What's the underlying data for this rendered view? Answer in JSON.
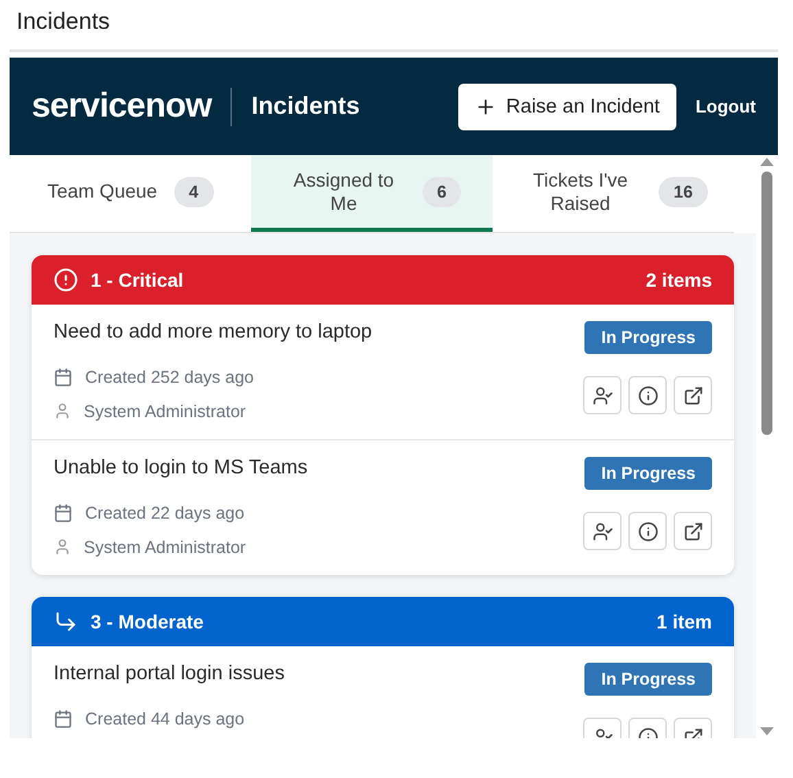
{
  "page_title": "Incidents",
  "header": {
    "logo": "servicenow",
    "title": "Incidents",
    "raise_button": "Raise an Incident",
    "logout": "Logout"
  },
  "tabs": [
    {
      "label": "Team Queue",
      "count": "4",
      "selected": false
    },
    {
      "label": "Assigned to Me",
      "count": "6",
      "selected": true
    },
    {
      "label": "Tickets I've Raised",
      "count": "16",
      "selected": false
    }
  ],
  "groups": [
    {
      "kind": "critical",
      "label": "1 - Critical",
      "count": "2 items",
      "color": "#d9202b",
      "items": [
        {
          "title": "Need to add more memory to laptop",
          "created": "Created 252 days ago",
          "assignee": "System Administrator",
          "status": "In Progress"
        },
        {
          "title": "Unable to login to MS Teams",
          "created": "Created 22 days ago",
          "assignee": "System Administrator",
          "status": "In Progress"
        }
      ]
    },
    {
      "kind": "moderate",
      "label": "3 - Moderate",
      "count": "1 item",
      "color": "#0064cc",
      "items": [
        {
          "title": "Internal portal login issues",
          "created": "Created 44 days ago",
          "status": "In Progress"
        }
      ]
    }
  ]
}
